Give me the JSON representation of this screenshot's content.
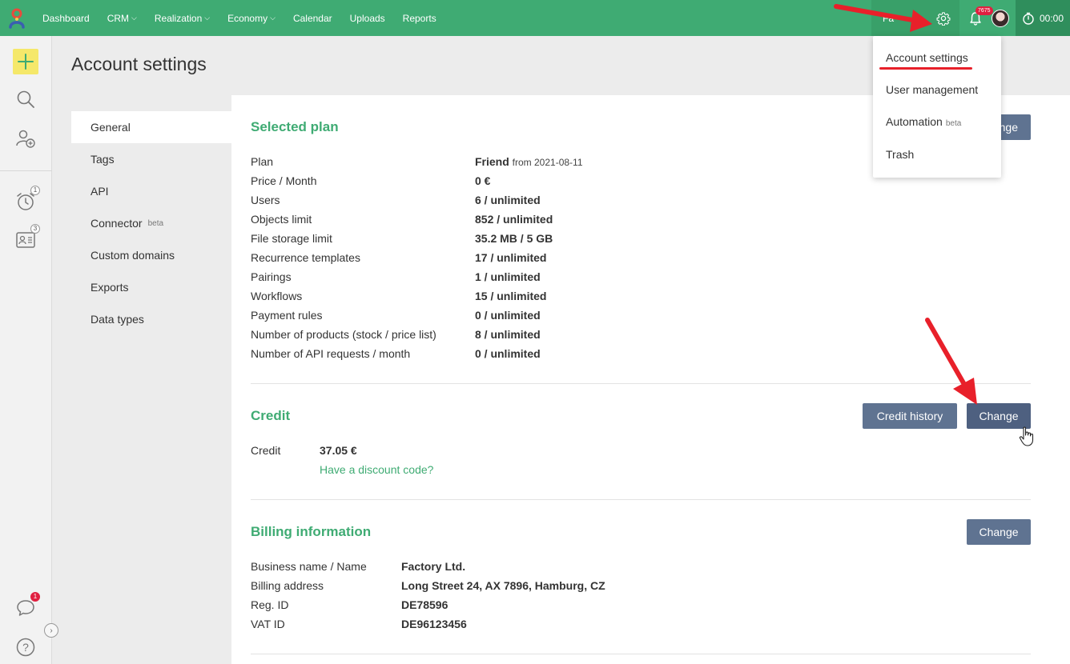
{
  "topbar": {
    "nav": [
      {
        "label": "Dashboard",
        "caret": false
      },
      {
        "label": "CRM",
        "caret": true
      },
      {
        "label": "Realization",
        "caret": true
      },
      {
        "label": "Economy",
        "caret": true
      },
      {
        "label": "Calendar",
        "caret": false
      },
      {
        "label": "Uploads",
        "caret": false
      },
      {
        "label": "Reports",
        "caret": false
      }
    ],
    "partial_label": "Fa",
    "notification_count": "7675",
    "timer": "00:00"
  },
  "rail": {
    "reminders_badge": "1",
    "tasks_badge": "3",
    "chat_badge": "1"
  },
  "page_title": "Account settings",
  "subnav": {
    "general": "General",
    "tags": "Tags",
    "api": "API",
    "connector": "Connector",
    "connector_beta": "beta",
    "custom_domains": "Custom domains",
    "exports": "Exports",
    "data_types": "Data types"
  },
  "plan": {
    "title": "Selected plan",
    "change_partial": "nge",
    "rows": [
      {
        "label": "Plan",
        "value": "Friend",
        "sub": "from 2021-08-11"
      },
      {
        "label": "Price / Month",
        "value": "0 €"
      },
      {
        "label": "Users",
        "value": "6 / unlimited"
      },
      {
        "label": "Objects limit",
        "value": "852 / unlimited"
      },
      {
        "label": "File storage limit",
        "value": "35.2 MB / 5 GB"
      },
      {
        "label": "Recurrence templates",
        "value": "17 / unlimited"
      },
      {
        "label": "Pairings",
        "value": "1 / unlimited"
      },
      {
        "label": "Workflows",
        "value": "15 / unlimited"
      },
      {
        "label": "Payment rules",
        "value": "0 / unlimited"
      },
      {
        "label": "Number of products (stock / price list)",
        "value": "8 / unlimited"
      },
      {
        "label": "Number of API requests / month",
        "value": "0 / unlimited"
      }
    ]
  },
  "credit": {
    "title": "Credit",
    "history_button": "Credit history",
    "change_button": "Change",
    "label": "Credit",
    "value": "37.05 €",
    "discount_link": "Have a discount code?"
  },
  "billing": {
    "title": "Billing information",
    "change_button": "Change",
    "rows": [
      {
        "label": "Business name / Name",
        "value": "Factory Ltd."
      },
      {
        "label": "Billing address",
        "value": "Long Street 24, AX 7896, Hamburg, CZ"
      },
      {
        "label": "Reg. ID",
        "value": "DE78596"
      },
      {
        "label": "VAT ID",
        "value": "DE96123456"
      }
    ]
  },
  "dropdown": {
    "account_settings": "Account settings",
    "user_management": "User management",
    "automation": "Automation",
    "automation_beta": "beta",
    "trash": "Trash"
  },
  "colors": {
    "brand_green": "#3fab73",
    "button_slate": "#5f7391",
    "annotation_red": "#e8202a"
  }
}
